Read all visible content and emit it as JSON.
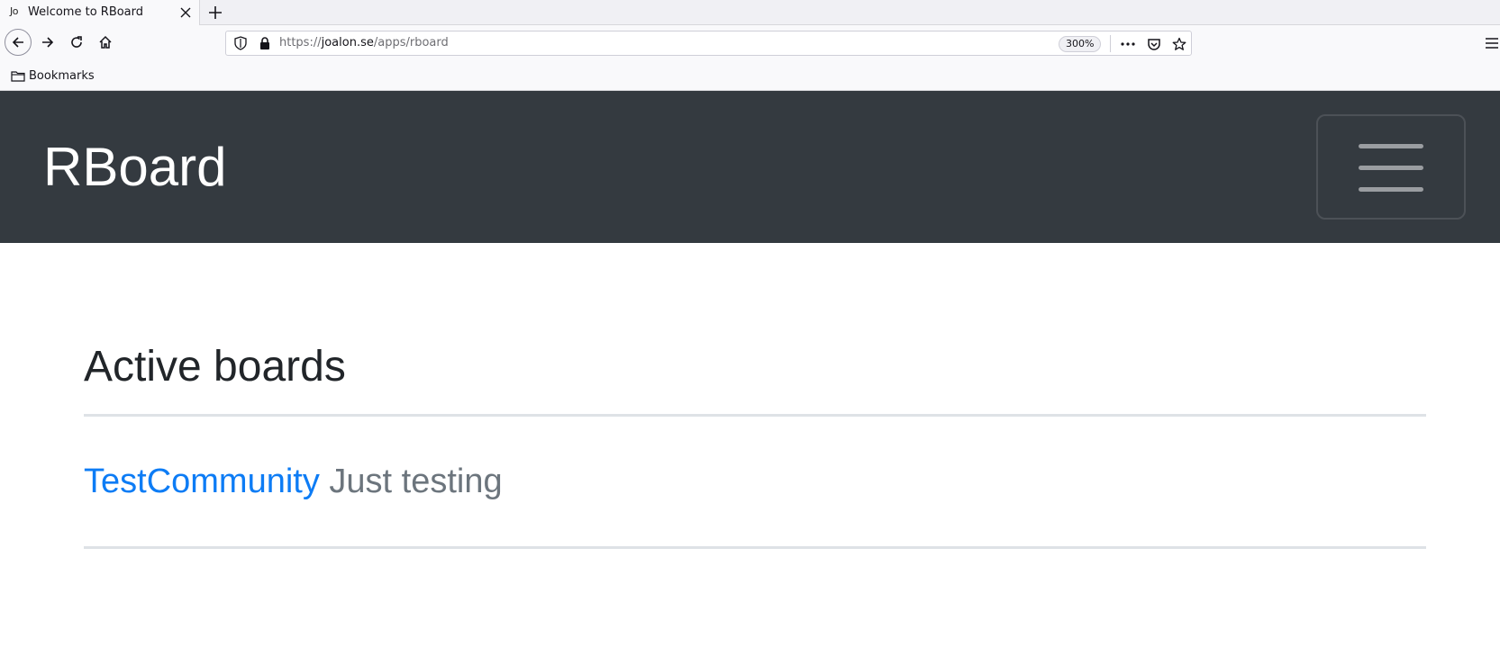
{
  "browser": {
    "tab": {
      "favicon_text": "Jo",
      "title": "Welcome to RBoard"
    },
    "url": {
      "scheme": "https://",
      "host": "joalon.se",
      "path": "/apps/rboard"
    },
    "zoom": "300%",
    "bookmarks_label": "Bookmarks"
  },
  "site": {
    "brand": "RBoard",
    "colors": {
      "navbar_bg": "#343a40",
      "link": "#0d7cf5",
      "muted": "#6c757d"
    }
  },
  "main": {
    "heading": "Active boards",
    "boards": [
      {
        "name": "TestCommunity",
        "description": "Just testing"
      }
    ]
  }
}
